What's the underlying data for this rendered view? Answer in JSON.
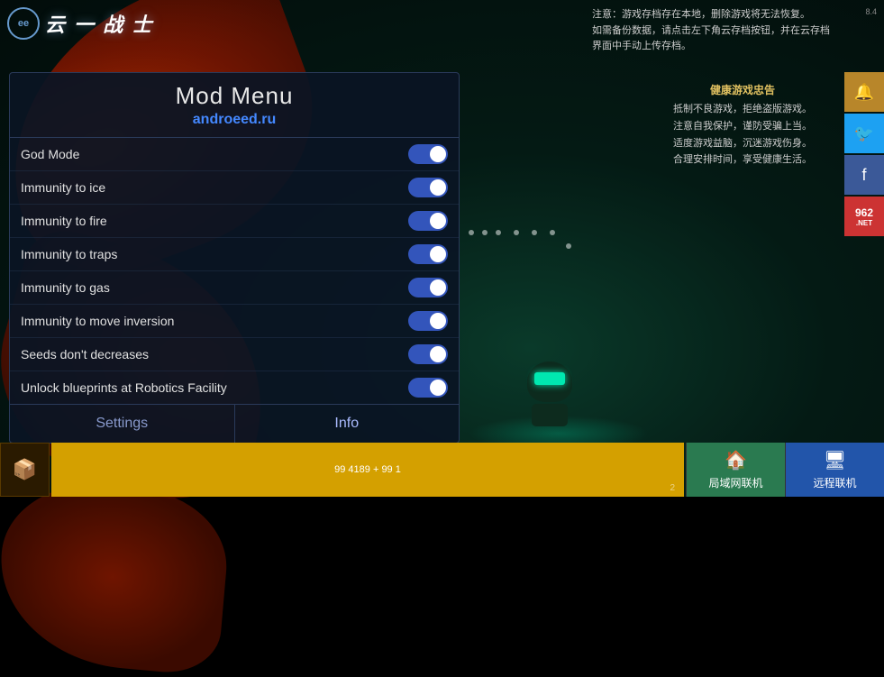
{
  "logo": {
    "circle_text": "ee",
    "text": "云 一 战 士"
  },
  "mod_menu": {
    "title": "Mod Menu",
    "subtitle": "androeed.ru",
    "toggles": [
      {
        "label": "God Mode",
        "state": "on"
      },
      {
        "label": "Immunity to ice",
        "state": "on"
      },
      {
        "label": "Immunity to fire",
        "state": "on"
      },
      {
        "label": "Immunity to traps",
        "state": "on"
      },
      {
        "label": "Immunity to gas",
        "state": "on"
      },
      {
        "label": "Immunity to move inversion",
        "state": "on"
      },
      {
        "label": "Seeds don't decreases",
        "state": "on"
      },
      {
        "label": "Unlock blueprints at Robotics Facility",
        "state": "on"
      }
    ],
    "footer": {
      "settings_label": "Settings",
      "info_label": "Info"
    }
  },
  "notice_top": {
    "line1": "注意：游戏存档存在本地，删除游戏将无法恢复。",
    "line2": "如需备份数据，请点击左下角云存档按钮，并在云存档",
    "line3": "界面中手动上传存档。",
    "small": "8.4"
  },
  "health_notice": {
    "title": "健康游戏忠告",
    "lines": [
      "抵制不良游戏，拒绝盗版游戏。",
      "注意自我保护，谨防受骗上当。",
      "适度游戏益脑，沉迷游戏伤身。",
      "合理安排时间，享受健康生活。"
    ]
  },
  "bottom_bar": {
    "gold_bar_text": "99 4189 + 99 1",
    "gold_bar_num": "2",
    "lan_label": "局域网联机",
    "remote_label": "远程联机"
  },
  "watermark": "99 4189 + 99 1"
}
